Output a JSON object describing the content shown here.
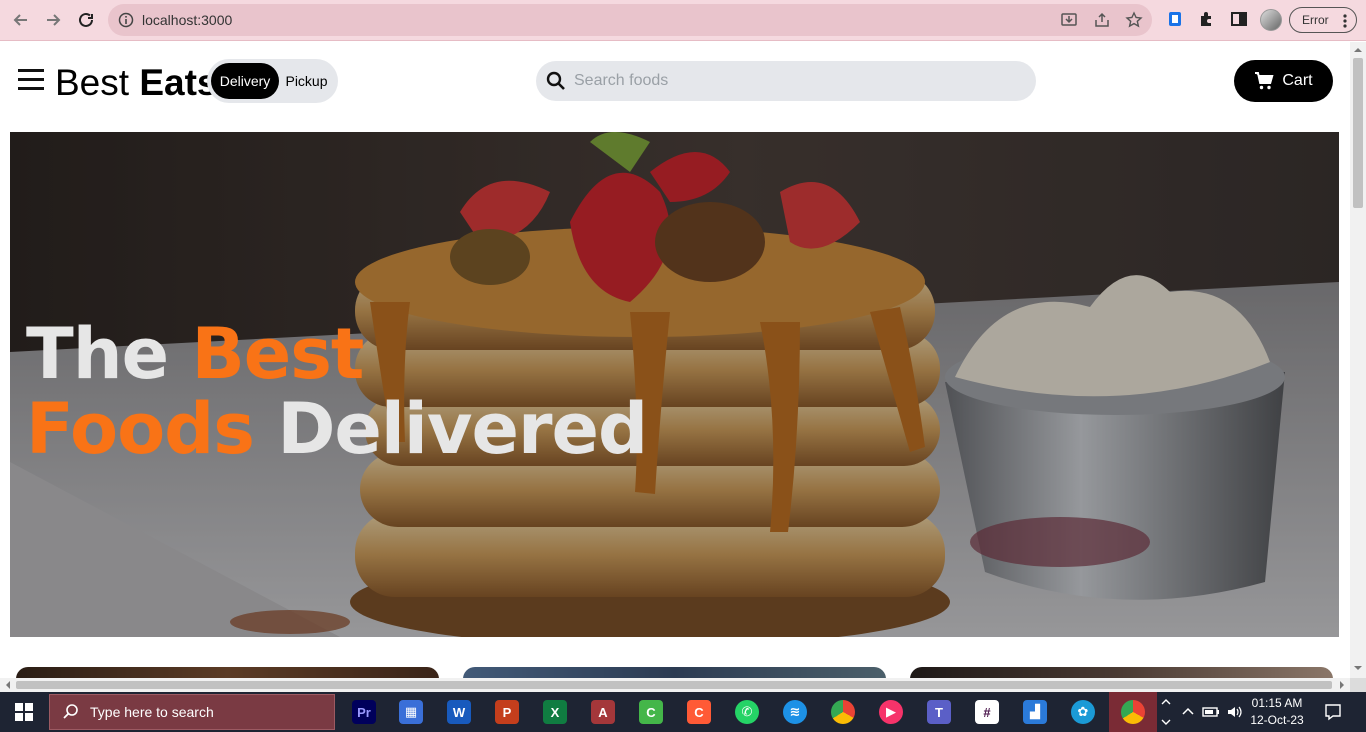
{
  "browser": {
    "url": "localhost:3000",
    "error_label": "Error"
  },
  "header": {
    "brand_light": "Best",
    "brand_bold": "Eats",
    "toggle": {
      "active": "Delivery",
      "inactive": "Pickup"
    },
    "search_placeholder": "Search foods",
    "cart_label": "Cart"
  },
  "hero": {
    "line1_plain": "The",
    "line1_accent": "Best",
    "line2_accent": "Foods",
    "line2_plain": "Delivered"
  },
  "colors": {
    "accent": "#f97316",
    "dark": "#000000",
    "pill_bg": "#e5e7eb"
  },
  "taskbar": {
    "search_placeholder": "Type here to search",
    "time": "01:15 AM",
    "date": "12-Oct-23",
    "apps": [
      "premiere-pro",
      "remote-desktop",
      "word",
      "powerpoint",
      "excel",
      "access",
      "camtasia",
      "canva",
      "whatsapp",
      "docker",
      "chrome",
      "media-player",
      "teams",
      "slack",
      "azure-data-studio",
      "virtualbox",
      "chrome-active"
    ]
  }
}
